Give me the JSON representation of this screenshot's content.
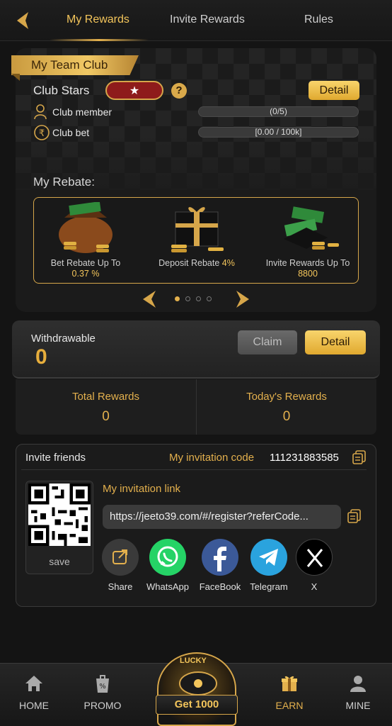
{
  "nav": {
    "tabs": [
      "My Rewards",
      "Invite Rewards",
      "Rules"
    ]
  },
  "club": {
    "ribbon": "My Team Club",
    "stars_label": "Club Stars",
    "star_glyph": "★",
    "help": "?",
    "detail": "Detail",
    "member_label": "Club member",
    "member_value": "(0/5)",
    "bet_label": "Club bet",
    "bet_value": "[0.00 / 100k]",
    "rebate_title": "My Rebate:",
    "rebates": [
      {
        "label": "Bet Rebate Up To",
        "value": "0.37 %"
      },
      {
        "label": "Deposit Rebate",
        "value": "4%"
      },
      {
        "label": "Invite Rewards Up To",
        "value": "8800"
      }
    ]
  },
  "withdraw": {
    "label": "Withdrawable",
    "amount": "0",
    "claim": "Claim",
    "detail": "Detail"
  },
  "rewards": {
    "total_label": "Total Rewards",
    "total_value": "0",
    "today_label": "Today's Rewards",
    "today_value": "0"
  },
  "invite": {
    "title": "Invite friends",
    "code_label": "My invitation code",
    "code": "111231883585",
    "link_label": "My invitation link",
    "link": "https://jeeto39.com/#/register?referCode...",
    "save": "save",
    "share": [
      {
        "label": "Share",
        "icon": "share-icon"
      },
      {
        "label": "WhatsApp",
        "icon": "whatsapp-icon"
      },
      {
        "label": "FaceBook",
        "icon": "facebook-icon"
      },
      {
        "label": "Telegram",
        "icon": "telegram-icon"
      },
      {
        "label": "X",
        "icon": "x-icon"
      }
    ]
  },
  "bottom_nav": {
    "home": "HOME",
    "promo": "PROMO",
    "lucky": "LUCKY",
    "center": "Get 1000",
    "earn": "EARN",
    "mine": "MINE"
  },
  "colors": {
    "gold": "#f3c55b",
    "bg": "#141414"
  }
}
